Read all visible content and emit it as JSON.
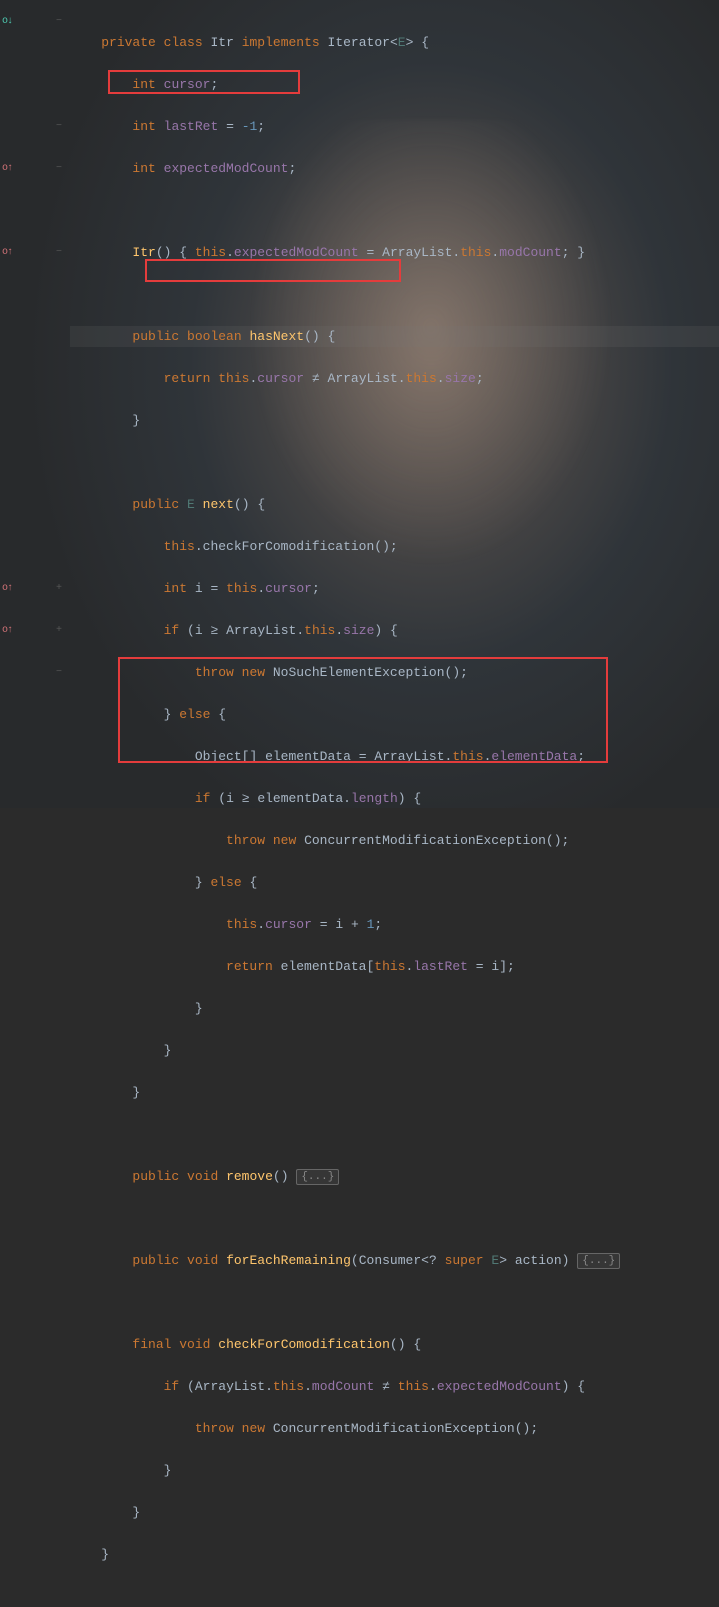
{
  "gutter_marks": [
    {
      "row": 0,
      "text": "o↓",
      "cls": "cyan"
    },
    {
      "row": 7,
      "text": "o↑",
      "cls": "red"
    },
    {
      "row": 11,
      "text": "o↑",
      "cls": "red"
    },
    {
      "row": 27,
      "text": "o↑",
      "cls": "red"
    },
    {
      "row": 29,
      "text": "o↑",
      "cls": "red"
    }
  ],
  "gutter_ticks": [
    0,
    5,
    7,
    11,
    27,
    29,
    31
  ],
  "fold": "{...}",
  "tokens": {
    "private": "private",
    "class": "class",
    "Itr": "Itr",
    "implements": "implements",
    "Iterator": "Iterator",
    "E": "E",
    "int": "int",
    "cursor": "cursor",
    "lastRet": "lastRet",
    "minus1": "-1",
    "expectedModCount": "expectedModCount",
    "ItrCtor": "Itr",
    "this": "this",
    "ArrayList": "ArrayList",
    "modCount": "modCount",
    "public": "public",
    "boolean": "boolean",
    "hasNext": "hasNext",
    "return": "return",
    "size": "size",
    "next": "next",
    "checkForComodification": "checkForComodification",
    "i": "i",
    "if": "if",
    "throw": "throw",
    "new": "new",
    "NoSuchElementException": "NoSuchElementException",
    "else": "else",
    "Object": "Object",
    "elementData": "elementData",
    "length": "length",
    "ConcurrentModificationException": "ConcurrentModificationException",
    "plus": "+",
    "one": "1",
    "void": "void",
    "remove": "remove",
    "forEachRemaining": "forEachRemaining",
    "Consumer": "Consumer",
    "super": "super",
    "action": "action",
    "final": "final",
    "ne": "≠",
    "ge": "≥"
  }
}
